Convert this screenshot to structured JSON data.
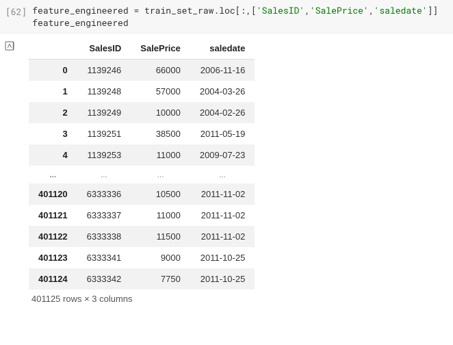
{
  "cell": {
    "number_label": "[62]",
    "code_text": "feature_engineered = train_set_raw.loc[:,['SalesID','SalePrice','saledate']]\nfeature_engineered"
  },
  "output": {
    "columns": [
      "SalesID",
      "SalePrice",
      "saledate"
    ],
    "rows_head": [
      {
        "index": "0",
        "SalesID": "1139246",
        "SalePrice": "66000",
        "saledate": "2006-11-16"
      },
      {
        "index": "1",
        "SalesID": "1139248",
        "SalePrice": "57000",
        "saledate": "2004-03-26"
      },
      {
        "index": "2",
        "SalesID": "1139249",
        "SalePrice": "10000",
        "saledate": "2004-02-26"
      },
      {
        "index": "3",
        "SalesID": "1139251",
        "SalePrice": "38500",
        "saledate": "2011-05-19"
      },
      {
        "index": "4",
        "SalesID": "1139253",
        "SalePrice": "11000",
        "saledate": "2009-07-23"
      }
    ],
    "ellipsis": "...",
    "rows_tail": [
      {
        "index": "401120",
        "SalesID": "6333336",
        "SalePrice": "10500",
        "saledate": "2011-11-02"
      },
      {
        "index": "401121",
        "SalesID": "6333337",
        "SalePrice": "11000",
        "saledate": "2011-11-02"
      },
      {
        "index": "401122",
        "SalesID": "6333338",
        "SalePrice": "11500",
        "saledate": "2011-11-02"
      },
      {
        "index": "401123",
        "SalesID": "6333341",
        "SalePrice": "9000",
        "saledate": "2011-10-25"
      },
      {
        "index": "401124",
        "SalesID": "6333342",
        "SalePrice": "7750",
        "saledate": "2011-10-25"
      }
    ],
    "shape_text": "401125 rows × 3 columns"
  }
}
